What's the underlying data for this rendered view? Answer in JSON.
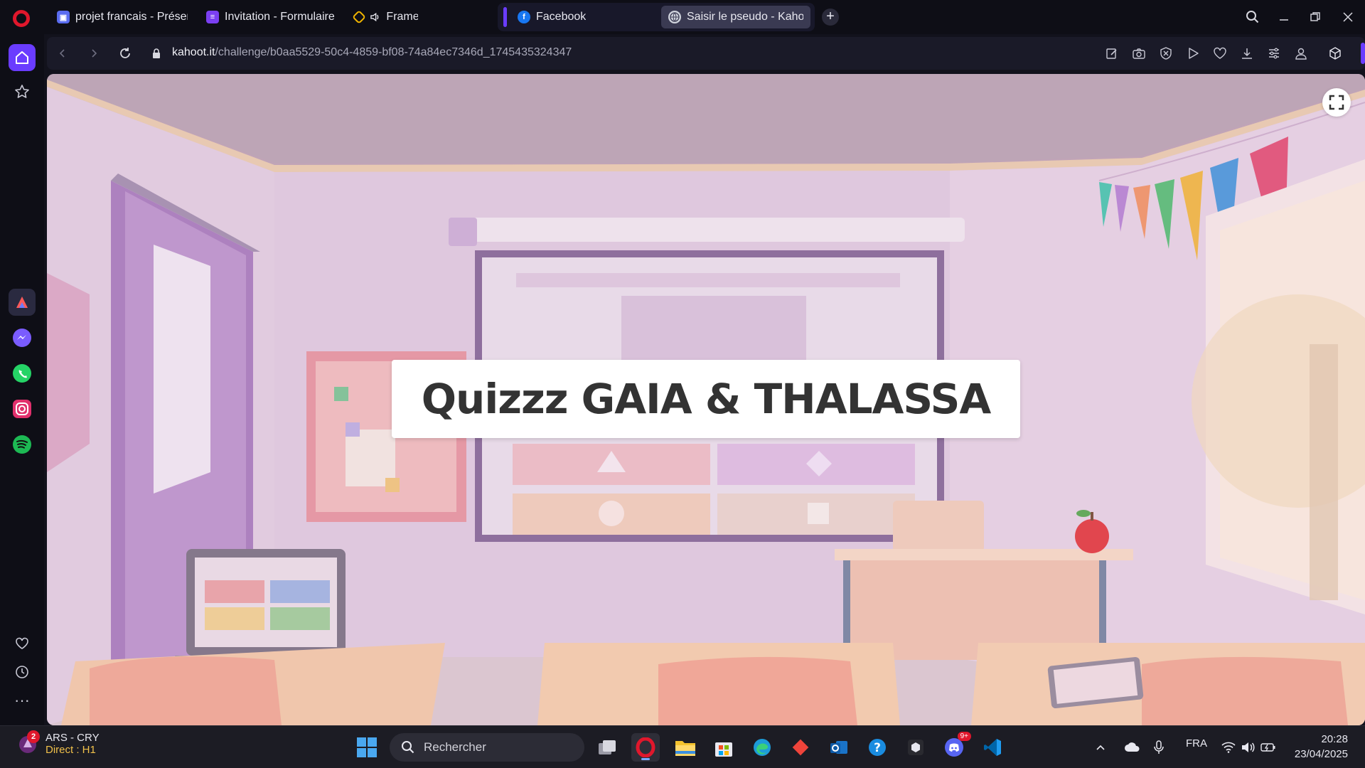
{
  "browser": {
    "tabs": [
      {
        "title": "projet francais - Présentati",
        "favicon": "presentation-icon",
        "color": "#5a6cf0"
      },
      {
        "title": "Invitation - Formulaire de",
        "favicon": "form-icon",
        "color": "#7b3ff2"
      },
      {
        "title": "Frame",
        "favicon": "frame-icon",
        "color": "#f0b400"
      },
      {
        "title": "Facebook",
        "favicon": "facebook-icon",
        "color": "#1877f2"
      },
      {
        "title": "Saisir le pseudo - Kahoots",
        "favicon": "globe-icon",
        "color": "#cfd3dc",
        "active": true
      }
    ],
    "address": {
      "host": "kahoot.it",
      "path": "/challenge/b0aa5529-50c4-4859-bf08-74a84ec7346d_1745435324347"
    },
    "accent_color": "#6a3cff"
  },
  "page": {
    "title": "Quizzz GAIA & THALASSA"
  },
  "taskbar": {
    "weather_line1": "ARS - CRY",
    "weather_line2": "Direct : H1",
    "notification_count": "2",
    "search_placeholder": "Rechercher",
    "discord_badge": "9+",
    "language": "FRA",
    "time": "20:28",
    "date": "23/04/2025"
  }
}
